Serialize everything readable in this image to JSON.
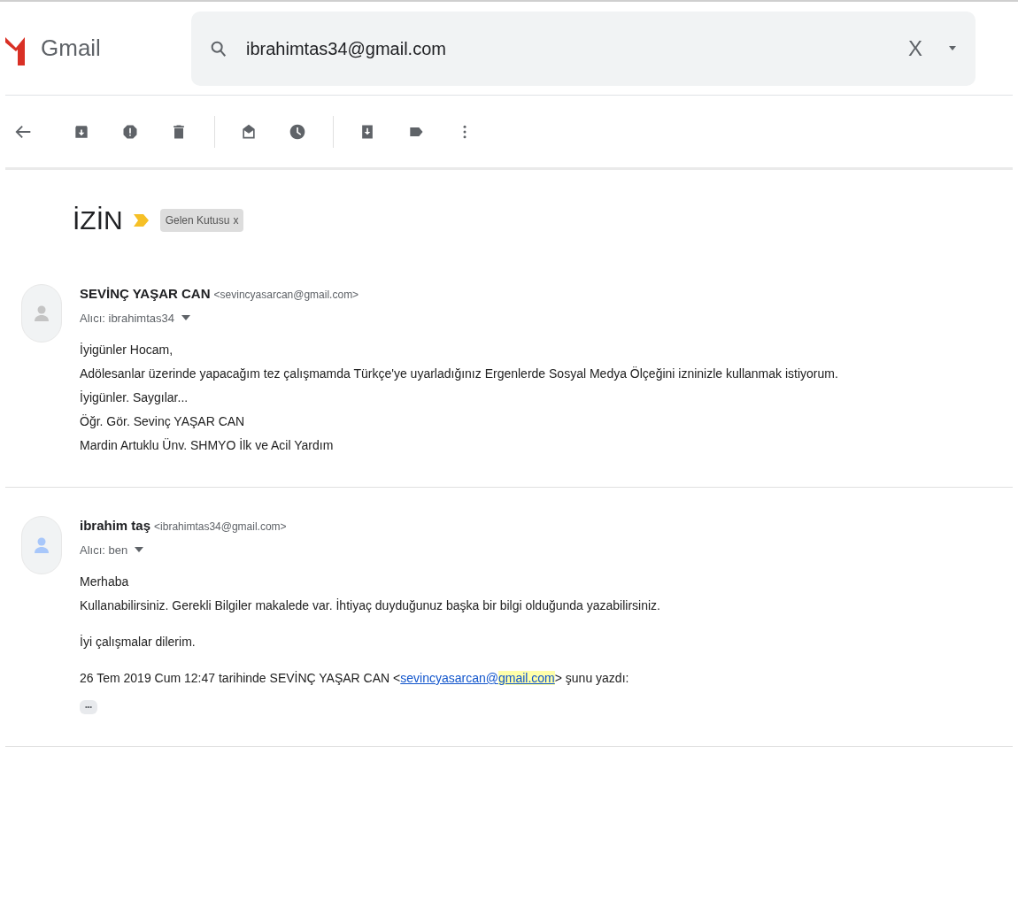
{
  "header": {
    "logo_text": "Gmail",
    "search": {
      "value": "ibrahimtas34@gmail.com",
      "clear": "X"
    }
  },
  "toolbar": {
    "groups": [
      [
        {
          "kind": "archive"
        },
        {
          "kind": "spam"
        },
        {
          "kind": "delete"
        }
      ],
      [
        {
          "kind": "mark-unread"
        },
        {
          "kind": "snooze"
        }
      ],
      [
        {
          "kind": "move"
        },
        {
          "kind": "label"
        },
        {
          "kind": "more"
        }
      ]
    ]
  },
  "thread": {
    "subject": "İZİN",
    "label": {
      "text": "Gelen Kutusu",
      "remove": "x"
    }
  },
  "messages": [
    {
      "sender": "SEVİNÇ YAŞAR CAN",
      "email": "<sevincyasarcan@gmail.com>",
      "recipient": "Alıcı: ibrahimtas34",
      "color": "#c4c4c4",
      "paragraphs": [
        [
          "İyigünler Hocam,",
          "Adölesanlar üzerinde yapacağım tez çalışmamda Türkçe'ye uyarladığınız Ergenlerde Sosyal Medya Ölçeğini izninizle kullanmak istiyorum.",
          "İyigünler. Saygılar...",
          "Öğr. Gör. Sevinç YAŞAR CAN",
          "Mardin Artuklu Ünv. SHMYO İlk ve Acil Yardım"
        ]
      ]
    },
    {
      "sender": "ibrahim taş",
      "email": "<ibrahimtas34@gmail.com>",
      "recipient": "Alıcı: ben",
      "color": "#a8c7fa",
      "paragraphs": [
        [
          "Merhaba",
          "Kullanabilirsiniz. Gerekli Bilgiler makalede var. İhtiyaç duyduğunuz başka bir bilgi olduğunda yazabilirsiniz."
        ],
        [
          "İyi çalışmalar dilerim."
        ]
      ],
      "quote": {
        "before": "26 Tem 2019 Cum 12:47 tarihinde SEVİNÇ YAŞAR CAN <",
        "link": {
          "plain": "sevincyasarcan@",
          "highlighted": "gmail.com"
        },
        "after": "> şunu yazdı:",
        "expand": "•••"
      }
    }
  ]
}
